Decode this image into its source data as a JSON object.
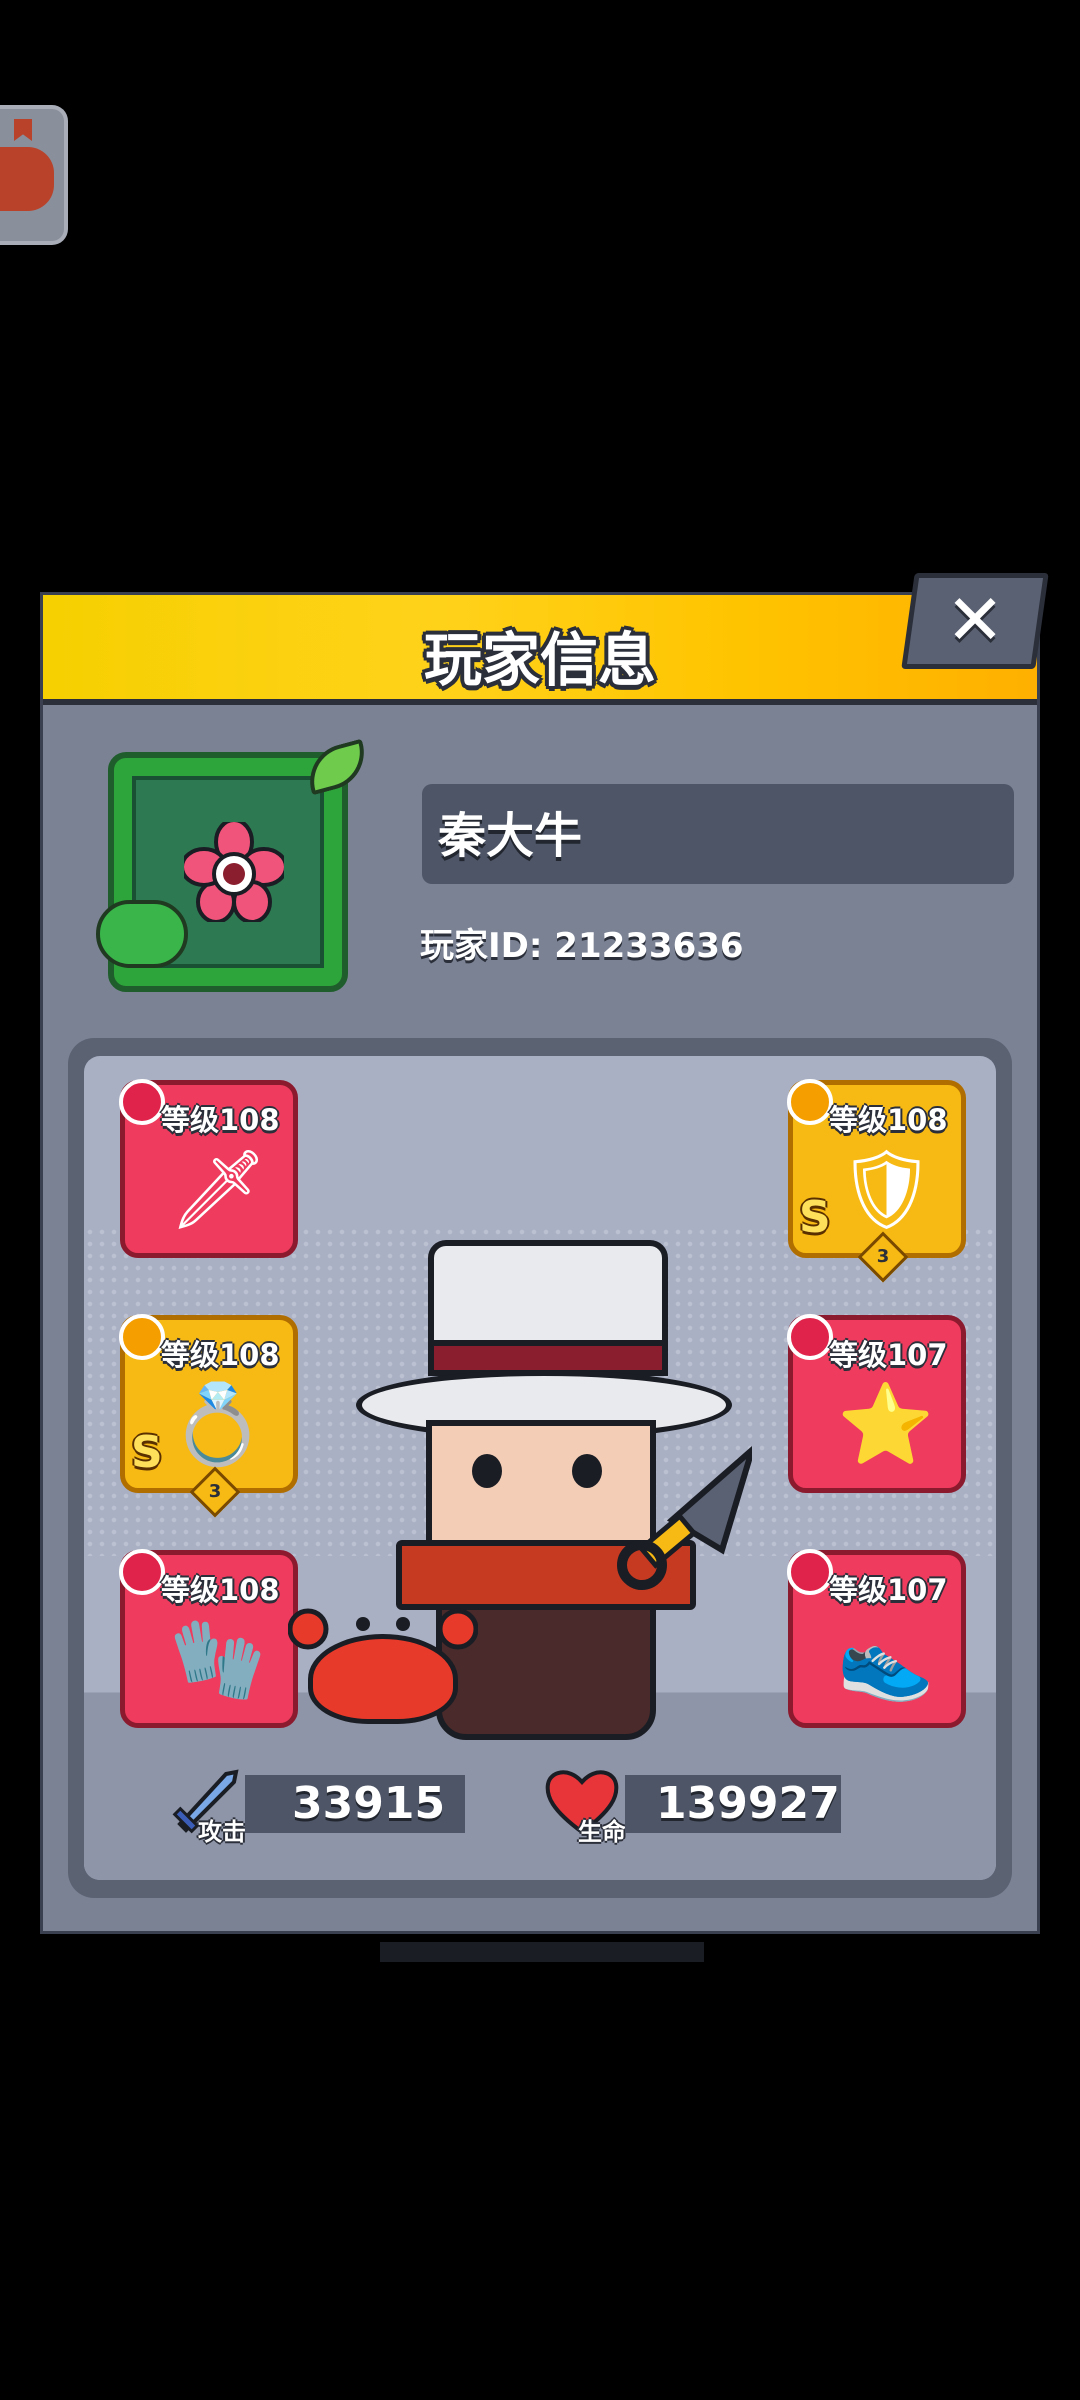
{
  "dialog": {
    "title": "玩家信息",
    "close_label": "✕"
  },
  "player": {
    "name": "秦大牛",
    "id_label": "玩家ID: 21233636"
  },
  "equipment": {
    "weapon": {
      "level": "等级108"
    },
    "armor": {
      "level": "等级108",
      "grade": "S",
      "stars": "3"
    },
    "ring": {
      "level": "等级108",
      "grade": "S",
      "stars": "3"
    },
    "collar": {
      "level": "等级107"
    },
    "gloves": {
      "level": "等级108"
    },
    "boots": {
      "level": "等级107"
    }
  },
  "stats": {
    "attack_label": "攻击",
    "attack_value": "33915",
    "hp_label": "生命",
    "hp_value": "139927"
  },
  "colors": {
    "header": "#ffd21a",
    "panel": "#7a8294",
    "slot_red": "#ef3b5d",
    "slot_gold": "#f7b913"
  }
}
